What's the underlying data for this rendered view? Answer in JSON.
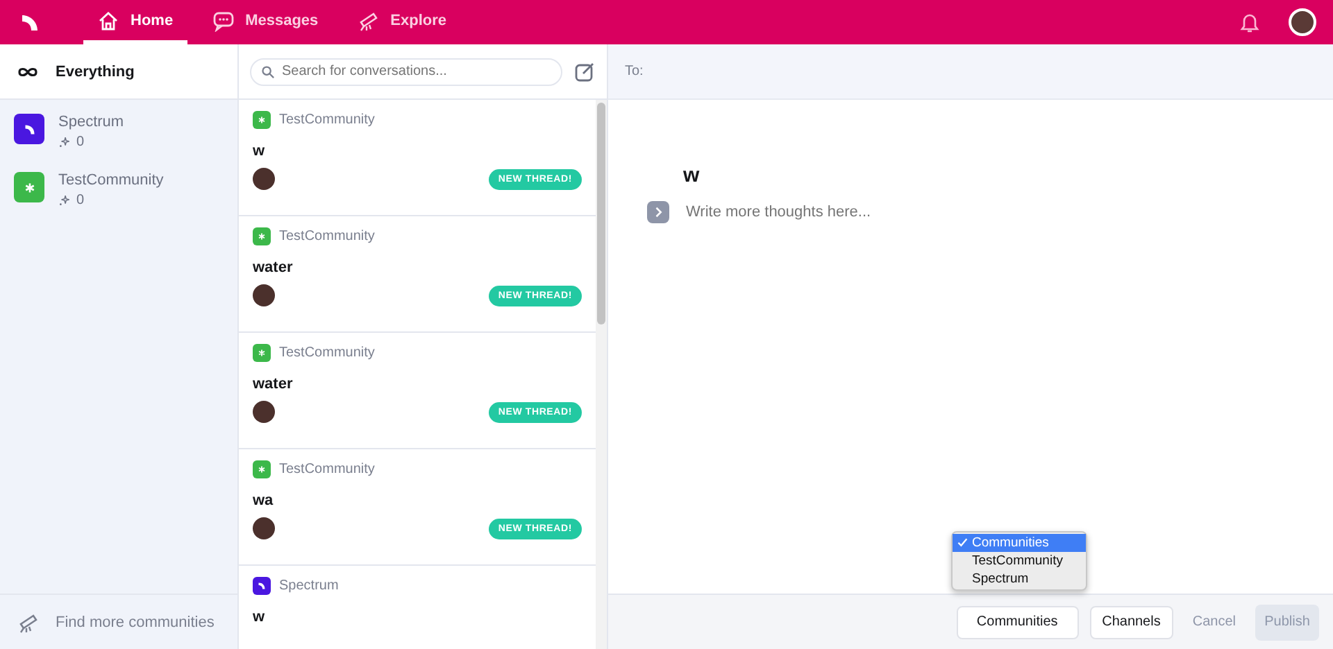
{
  "nav": {
    "tabs": [
      {
        "label": "Home",
        "kind": "home",
        "selected": true
      },
      {
        "label": "Messages",
        "kind": "messages",
        "selected": false
      },
      {
        "label": "Explore",
        "kind": "explore",
        "selected": false
      }
    ]
  },
  "sidebar": {
    "everything": "Everything",
    "communities": [
      {
        "name": "Spectrum",
        "kind": "spectrum",
        "color": "#4a17e0",
        "count": "0"
      },
      {
        "name": "TestCommunity",
        "kind": "test",
        "color": "#3cb84a",
        "count": "0"
      }
    ],
    "footer": "Find more communities"
  },
  "threads": {
    "search": {
      "placeholder": "Search for conversations..."
    },
    "items": [
      {
        "community": "TestCommunity",
        "kind": "test",
        "color": "#3cb84a",
        "title": "w",
        "badge": "NEW THREAD!"
      },
      {
        "community": "TestCommunity",
        "kind": "test",
        "color": "#3cb84a",
        "title": "water",
        "badge": "NEW THREAD!"
      },
      {
        "community": "TestCommunity",
        "kind": "test",
        "color": "#3cb84a",
        "title": "water",
        "badge": "NEW THREAD!"
      },
      {
        "community": "TestCommunity",
        "kind": "test",
        "color": "#3cb84a",
        "title": "wa",
        "badge": "NEW THREAD!"
      },
      {
        "community": "Spectrum",
        "kind": "spectrum",
        "color": "#4a17e0",
        "title": "w"
      }
    ]
  },
  "composer": {
    "to_label": "To:",
    "title": "w",
    "body_placeholder": "Write more thoughts here...",
    "dropdown": [
      {
        "label": "Communities",
        "selected": true
      },
      {
        "label": "TestCommunity",
        "selected": false
      },
      {
        "label": "Spectrum",
        "selected": false
      }
    ],
    "select_value": "Communities",
    "channels": "Channels",
    "cancel": "Cancel",
    "publish": {
      "label": "Publish",
      "disabled": true
    }
  }
}
